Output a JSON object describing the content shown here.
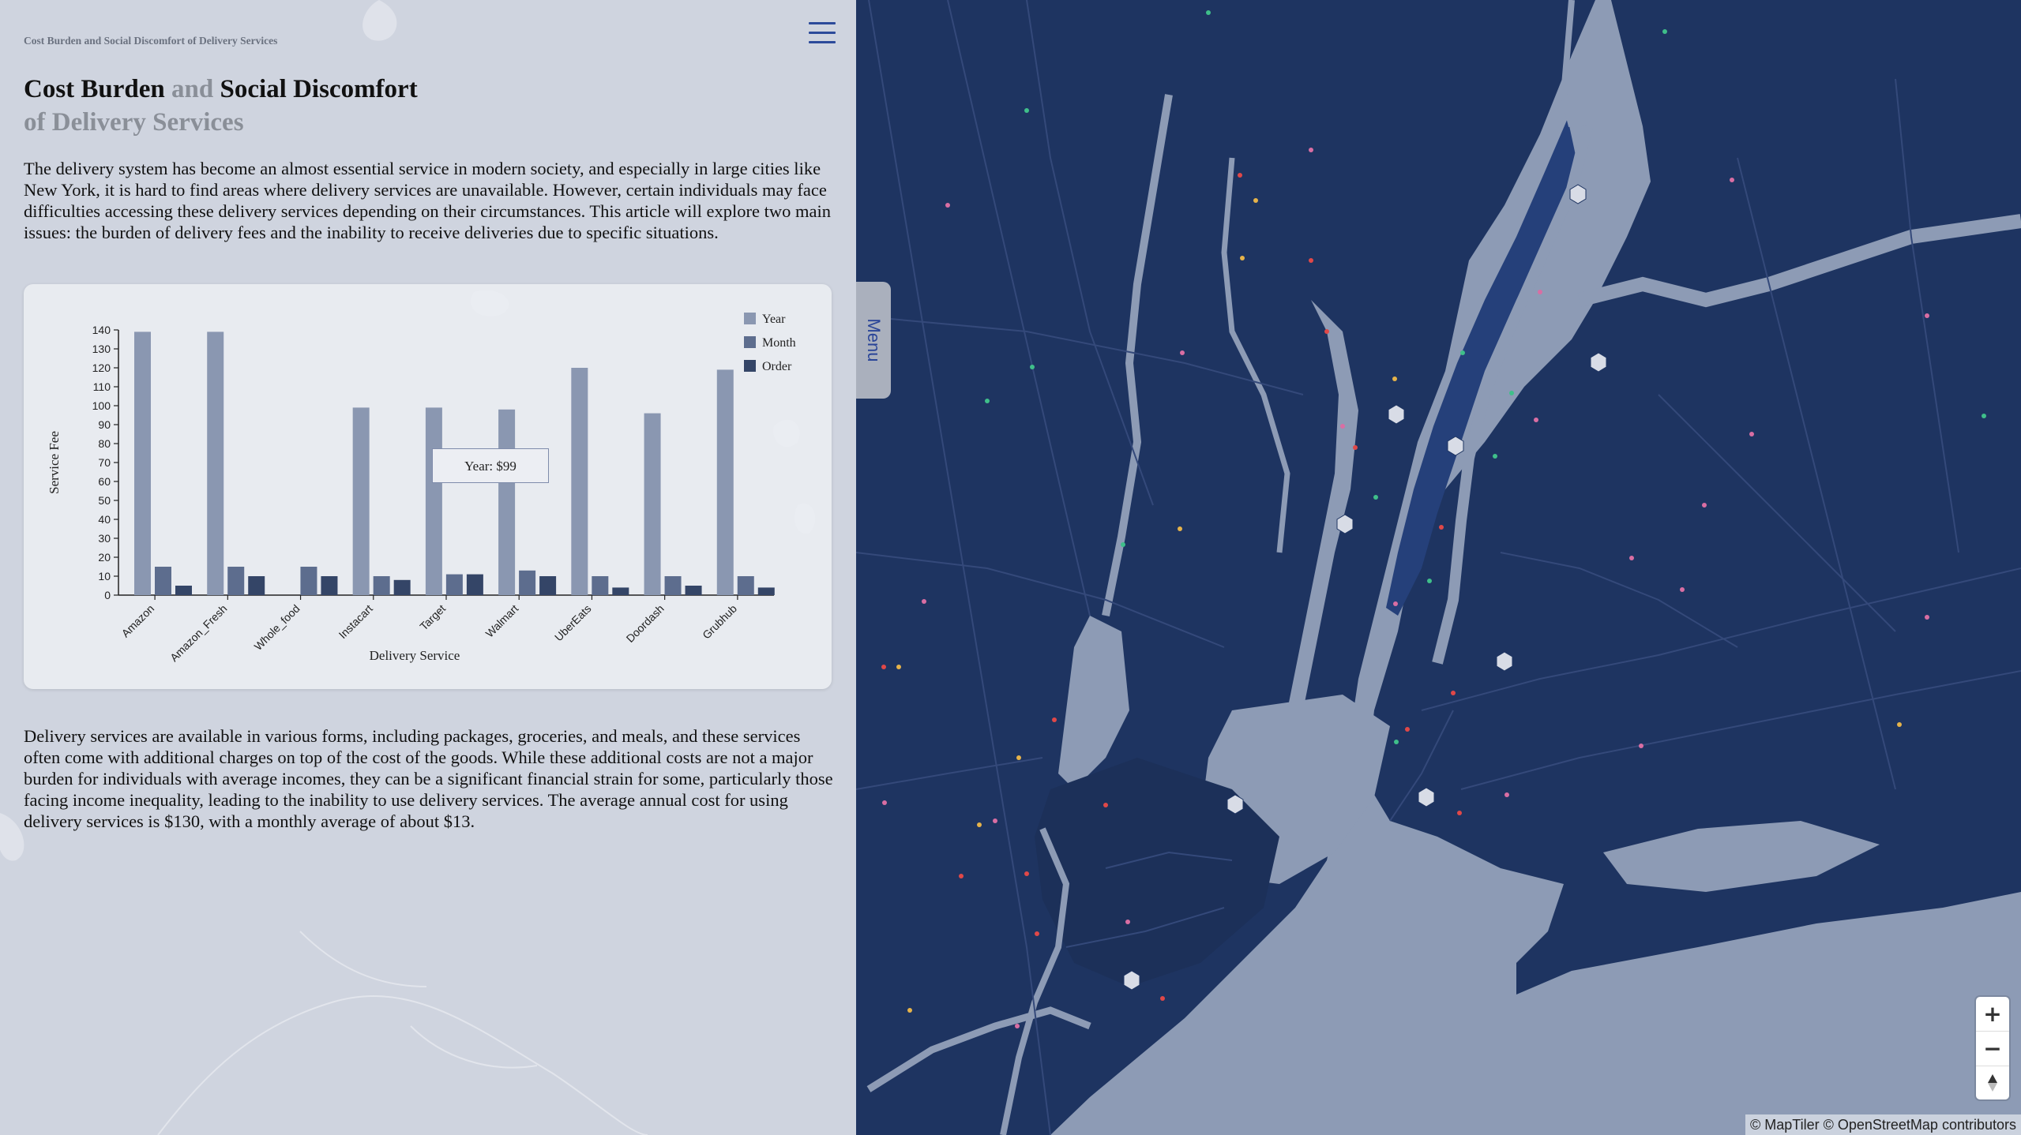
{
  "page": {
    "kicker": "Cost Burden and Social Discomfort of Delivery Services",
    "title": {
      "part1": "Cost Burden",
      "and": "and",
      "part2": "Social Discomfort",
      "line2": "of Delivery Services"
    },
    "paragraph1": "The delivery system has become an almost essential service in modern society, and especially in large cities like New York, it is hard to find areas where delivery services are unavailable. However, certain individuals may face difficulties accessing these delivery services depending on their circumstances. This article will explore two main issues: the burden of delivery fees and the inability to receive deliveries due to specific situations.",
    "paragraph2": "Delivery services are available in various forms, including packages, groceries, and meals, and these services often come with additional charges on top of the cost of the goods. While these additional costs are not a major burden for individuals with average incomes, they can be a significant financial strain for some, particularly those facing income inequality, leading to the inability to use delivery services. The average annual cost for using delivery services is $130, with a monthly average of about $13."
  },
  "menu": {
    "hamburger_icon": "hamburger-menu-icon",
    "tab_label": "Menu"
  },
  "map": {
    "zoom_in_label": "+",
    "zoom_out_label": "−",
    "compass_icon": "compass-icon",
    "attribution": "© MapTiler © OpenStreetMap contributors",
    "colors": {
      "land": "#1e3461",
      "water": "#8d9bb5",
      "roads": "#34497a"
    }
  },
  "chart_data": {
    "type": "bar",
    "categories": [
      "Amazon",
      "Amazon_Fresh",
      "Whole_food",
      "Instacart",
      "Target",
      "Walmart",
      "UberEats",
      "Doordash",
      "Grubhub"
    ],
    "series": [
      {
        "name": "Year",
        "color": "#8a97b1",
        "values": [
          139,
          139,
          0,
          99,
          99,
          98,
          120,
          96,
          119
        ]
      },
      {
        "name": "Month",
        "color": "#5d6d8e",
        "values": [
          15,
          15,
          15,
          10,
          11,
          13,
          10,
          10,
          10
        ]
      },
      {
        "name": "Order",
        "color": "#344567",
        "values": [
          5,
          10,
          10,
          8,
          11,
          10,
          4,
          5,
          4
        ]
      }
    ],
    "xlabel": "Delivery Service",
    "ylabel": "Service Fee",
    "ylim": [
      0,
      140
    ],
    "yticks": [
      0,
      10,
      20,
      30,
      40,
      50,
      60,
      70,
      80,
      90,
      100,
      110,
      120,
      130,
      140
    ],
    "legend_position": "top-right",
    "grid": false,
    "tooltip": "Year: $99"
  }
}
